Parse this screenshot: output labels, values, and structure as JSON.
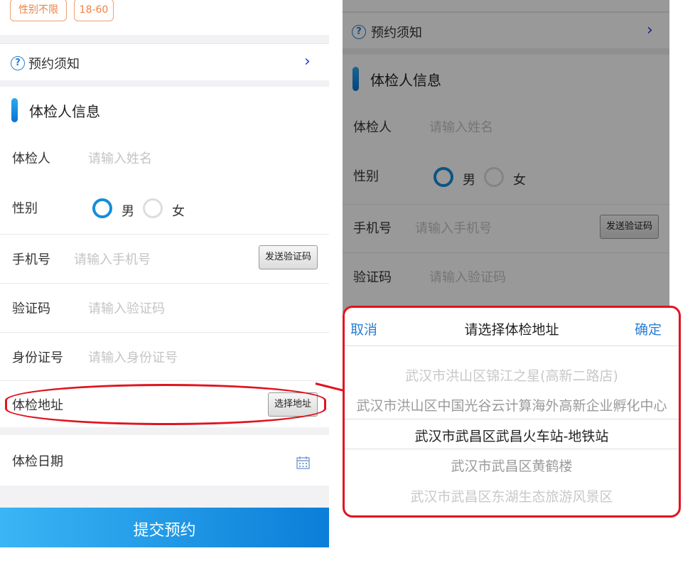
{
  "left": {
    "tags": [
      "性别不限",
      "18-60"
    ],
    "notice": {
      "label": "预约须知"
    },
    "section_title": "体检人信息",
    "fields": {
      "name": {
        "label": "体检人",
        "placeholder": "请输入姓名"
      },
      "gender": {
        "label": "性别",
        "options": [
          "男",
          "女"
        ],
        "selected": "男"
      },
      "phone": {
        "label": "手机号",
        "placeholder": "请输入手机号",
        "button": "发送验证码"
      },
      "code": {
        "label": "验证码",
        "placeholder": "请输入验证码"
      },
      "idcard": {
        "label": "身份证号",
        "placeholder": "请输入身份证号"
      },
      "address": {
        "label": "体检地址",
        "button": "选择地址"
      },
      "date": {
        "label": "体检日期"
      }
    },
    "submit_label": "提交预约"
  },
  "right": {
    "notice": {
      "label": "预约须知"
    },
    "section_title": "体检人信息",
    "fields": {
      "name": {
        "label": "体检人",
        "placeholder": "请输入姓名"
      },
      "gender": {
        "label": "性别",
        "options": [
          "男",
          "女"
        ],
        "selected": "男"
      },
      "phone": {
        "label": "手机号",
        "placeholder": "请输入手机号",
        "button": "发送验证码"
      },
      "code": {
        "label": "验证码",
        "placeholder": "请输入验证码"
      }
    },
    "picker": {
      "cancel": "取消",
      "title": "请选择体检地址",
      "confirm": "确定",
      "options": [
        "武汉市洪山区锦江之星(高新二路店)",
        "武汉市洪山区中国光谷云计算海外高新企业孵化中心",
        "武汉市武昌区武昌火车站-地铁站",
        "武汉市武昌区黄鹤楼",
        "武汉市武昌区东湖生态旅游风景区"
      ],
      "selected_option": "武汉市武昌区武昌火车站-地铁站"
    }
  },
  "colors": {
    "accent_blue": "#138ddc",
    "link_blue": "#2a7fd4",
    "highlight_red": "#e0141e",
    "tag_orange": "#f08040",
    "submit_gradient": [
      "#3ab5f5",
      "#0b7ed8"
    ]
  },
  "icons": {
    "help": "question-circle-icon",
    "next": "chevron-right-icon",
    "calendar": "calendar-icon"
  }
}
